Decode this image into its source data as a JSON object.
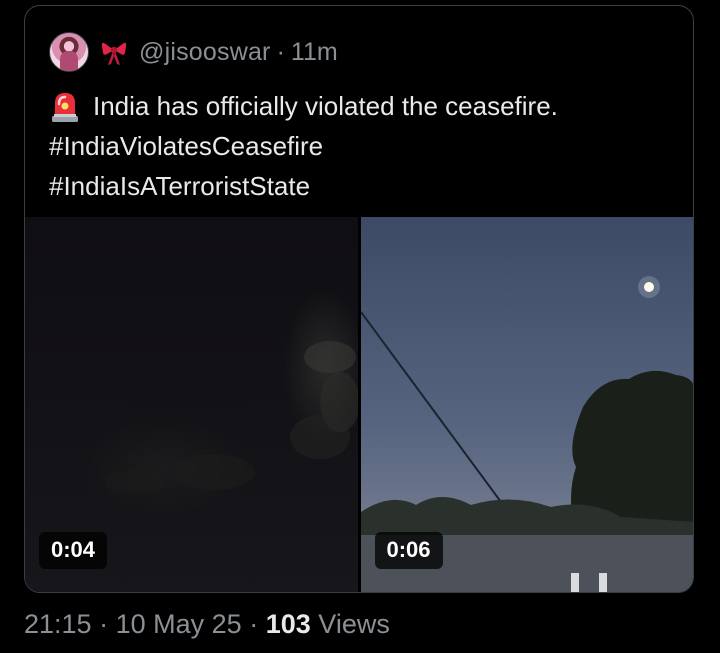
{
  "quote": {
    "author_handle": "@jisooswar",
    "separator": "·",
    "time_ago": "11m",
    "text_lines": [
      "India has officially violated the ceasefire.",
      "#IndiaViolatesCeasefire",
      "#IndiaIsATerroristState"
    ]
  },
  "media": [
    {
      "duration": "0:04"
    },
    {
      "duration": "0:06"
    }
  ],
  "footer": {
    "time": "21:15",
    "separator": "·",
    "date": "10 May 25",
    "views_count": "103",
    "views_label": "Views"
  },
  "icons": {
    "avatar": "avatar-image",
    "ribbon": "ribbon-emoji-icon",
    "siren": "siren-emoji-icon"
  },
  "colors": {
    "background": "#000000",
    "text_primary": "#e7e9ea",
    "text_secondary": "#8b9095",
    "border": "#3a3f44"
  }
}
